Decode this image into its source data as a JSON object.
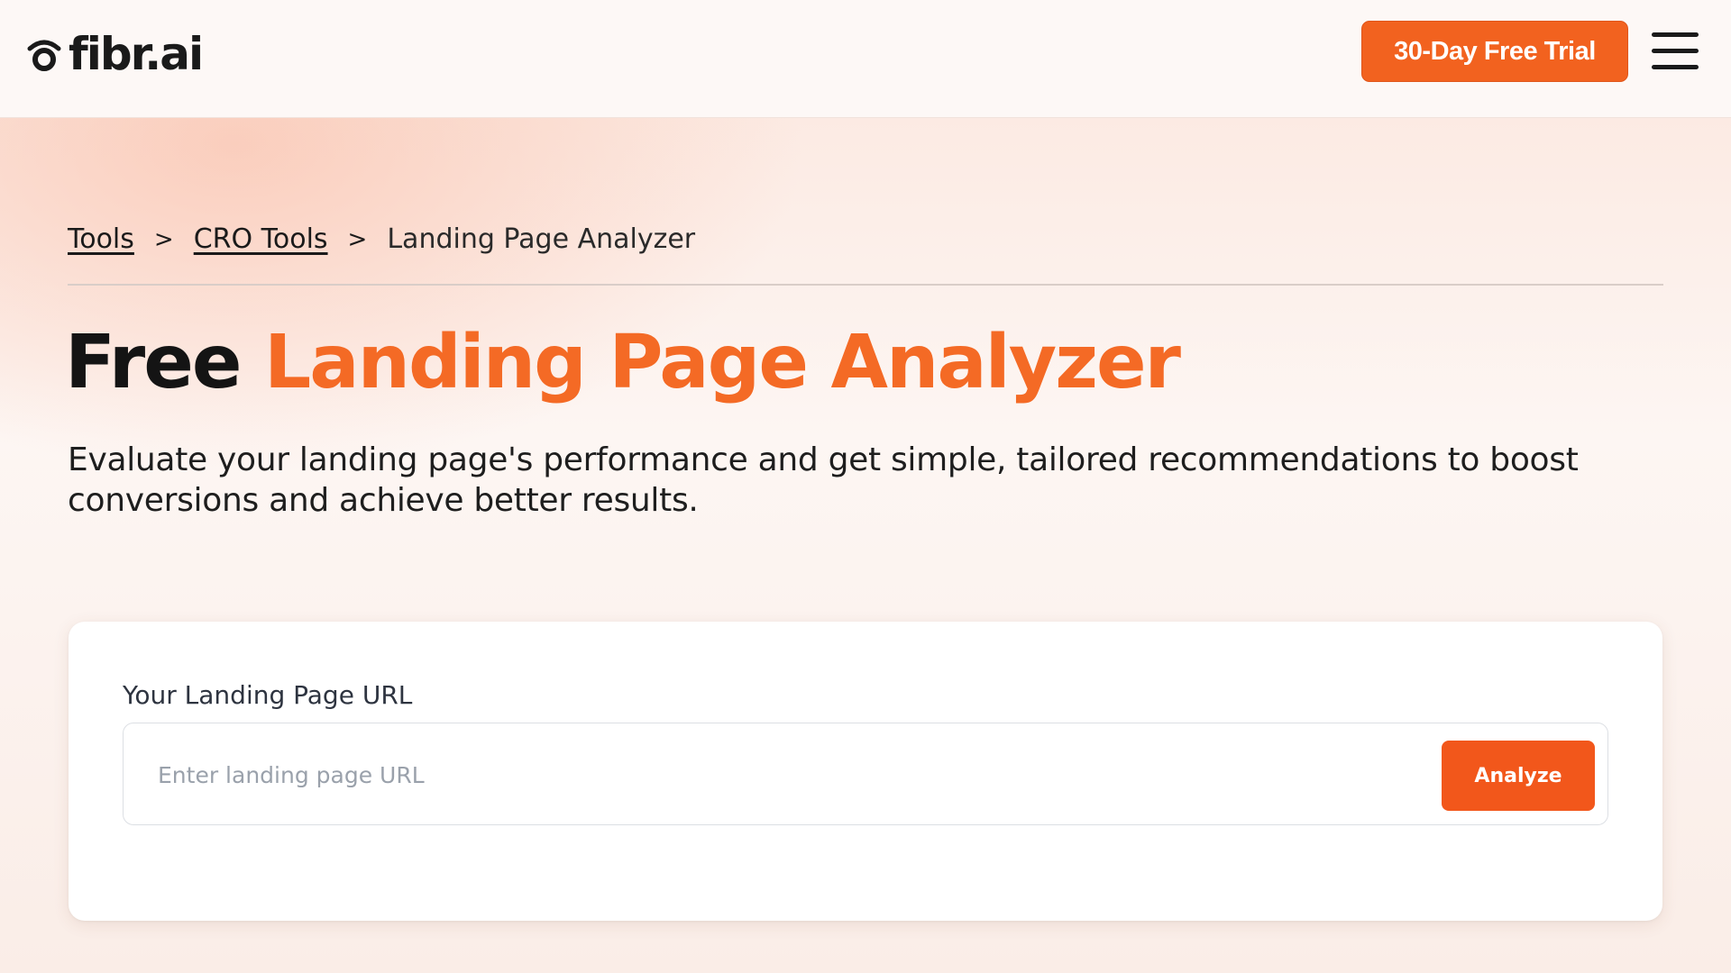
{
  "brand": {
    "name": "fibr.ai",
    "accent_color": "#f46a25",
    "button_color": "#f2621f"
  },
  "header": {
    "logo_icon": "fibr-logo-icon",
    "cta_label": "30-Day Free Trial",
    "menu_icon": "hamburger-menu-icon"
  },
  "breadcrumb": {
    "items": [
      {
        "label": "Tools"
      },
      {
        "label": "CRO Tools"
      }
    ],
    "separator": ">",
    "current": "Landing Page Analyzer"
  },
  "hero": {
    "title_plain": "Free",
    "title_accent": "Landing Page Analyzer",
    "subtitle": "Evaluate your landing page's performance and get simple, tailored recommendations to boost conversions and achieve better results."
  },
  "form": {
    "label": "Your Landing Page URL",
    "input_value": "",
    "input_placeholder": "Enter landing page URL",
    "submit_label": "Analyze"
  }
}
